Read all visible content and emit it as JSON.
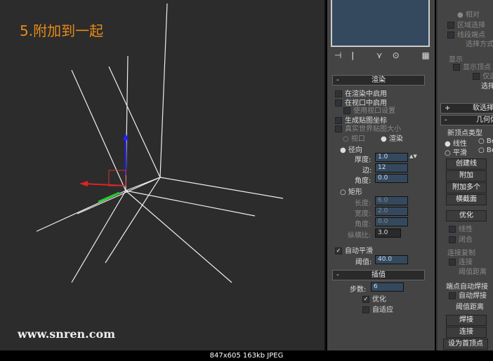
{
  "title": "5.附加到一起",
  "watermark": "www.snren.com",
  "status": "847x605  163kb  JPEG",
  "render": {
    "header": "渲染",
    "enable_render": "在渲染中启用",
    "enable_viewport": "在视口中启用",
    "use_viewport_settings": "使用视口设置",
    "gen_mapping": "生成贴图坐标",
    "real_world": "真实世界贴图大小",
    "viewport": "视口",
    "render_opt": "渲染",
    "radial": "径向",
    "thickness_label": "厚度:",
    "thickness": "1.0",
    "sides_label": "边:",
    "sides": "12",
    "angle_label": "角度:",
    "angle": "0.0",
    "rect": "矩形",
    "length_label": "长度:",
    "length": "6.0",
    "width_label": "宽度:",
    "width": "2.0",
    "angle2_label": "角度:",
    "angle2": "0.0",
    "aspect_label": "纵横比:",
    "aspect": "3.0",
    "auto_smooth": "自动平滑",
    "threshold_label": "阈值:",
    "threshold": "40.0"
  },
  "interp": {
    "header": "插值",
    "steps_label": "步数:",
    "steps": "6",
    "optimize": "优化",
    "adaptive": "自适应"
  },
  "right": {
    "relative": "相对",
    "area_select": "区域选择",
    "segment_end": "线段端点",
    "select_by": "选择方式",
    "display": "显示",
    "show_vertex": "显示顶点",
    "selected": "仅选",
    "select": "选择",
    "soft_select": "软选择",
    "geometry": "几何体",
    "new_vertex_type": "新顶点类型",
    "linear": "线性",
    "smooth": "平滑",
    "bezier": "Be",
    "bezier2": "Be",
    "create_line": "创建线",
    "attach": "附加",
    "attach_multi": "附加多个",
    "cross_section": "横截面",
    "optimize": "优化",
    "linear2": "线性",
    "close": "闭合",
    "connect_copy": "连接复制",
    "connect": "连接",
    "thresh_dist": "阈值距离",
    "end_weld": "端点自动焊接",
    "auto_weld": "自动焊接",
    "thresh_dist2": "阈值距离",
    "weld": "焊接",
    "connect_btn": "连接",
    "make_first": "设为首顶点"
  }
}
